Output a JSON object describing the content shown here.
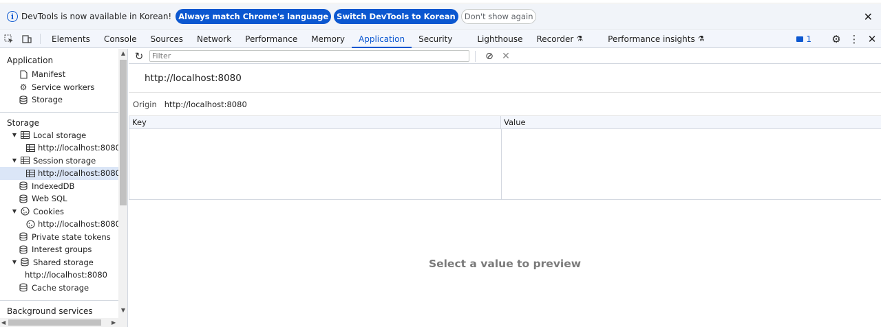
{
  "infobar": {
    "message": "DevTools is now available in Korean!",
    "btn_match": "Always match Chrome's language",
    "btn_switch": "Switch DevTools to Korean",
    "btn_dont_show": "Don't show again"
  },
  "tabs": [
    "Elements",
    "Console",
    "Sources",
    "Network",
    "Performance",
    "Memory",
    "Application",
    "Security",
    "Lighthouse",
    "Recorder",
    "Performance insights"
  ],
  "active_tab": "Application",
  "issues_count": "1",
  "sidebar": {
    "application_header": "Application",
    "application_items": [
      "Manifest",
      "Service workers",
      "Storage"
    ],
    "storage_header": "Storage",
    "local_storage": "Local storage",
    "local_storage_origin": "http://localhost:8080",
    "session_storage": "Session storage",
    "session_storage_origin": "http://localhost:8080",
    "indexeddb": "IndexedDB",
    "websql": "Web SQL",
    "cookies": "Cookies",
    "cookies_origin": "http://localhost:8080",
    "private_state_tokens": "Private state tokens",
    "interest_groups": "Interest groups",
    "shared_storage": "Shared storage",
    "shared_storage_origin": "http://localhost:8080",
    "cache_storage": "Cache storage",
    "background_services": "Background services"
  },
  "main": {
    "filter_placeholder": "Filter",
    "origin_title": "http://localhost:8080",
    "origin_label": "Origin",
    "origin_value": "http://localhost:8080",
    "col_key": "Key",
    "col_value": "Value",
    "preview_text": "Select a value to preview"
  },
  "colors": {
    "accent": "#0b57d0",
    "selected_bg": "#dbe6f7",
    "toolbar_bg": "#f3f6fc"
  }
}
